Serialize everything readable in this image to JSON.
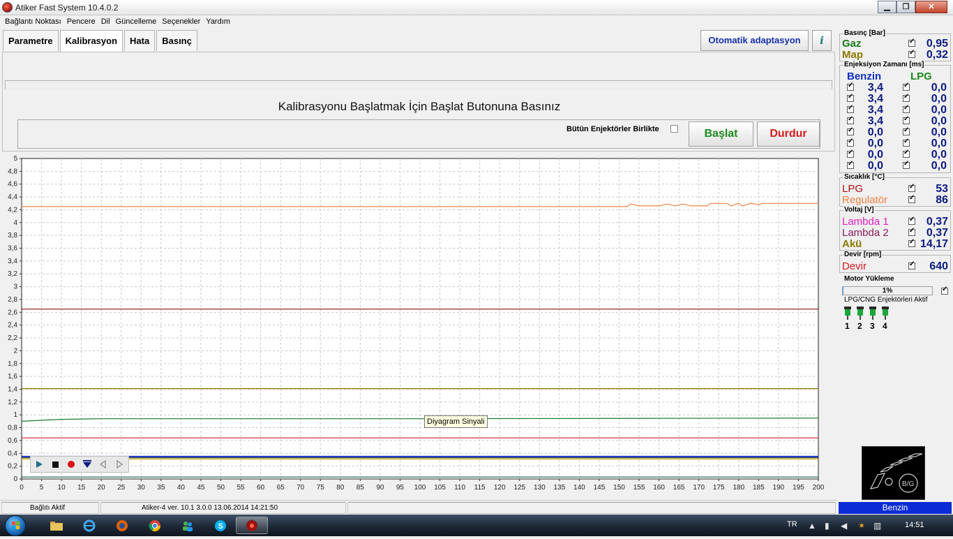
{
  "window": {
    "title": "Atiker Fast System  10.4.0.2",
    "buttons": {
      "minimize": "▁",
      "maximize": "❐",
      "close": "✕"
    }
  },
  "menu": [
    "Bağlantı Noktası",
    "Pencere",
    "Dil",
    "Güncelleme",
    "Seçenekler",
    "Yardım"
  ],
  "tabs": [
    "Parametre",
    "Kalibrasyon",
    "Hata",
    "Basınç"
  ],
  "active_tab": "Kalibrasyon",
  "auto_adapt_label": "Otomatik adaptasyon",
  "info_icon": "i",
  "calibration": {
    "message": "Kalibrasyonu Başlatmak İçin Başlat Butonuna Basınız",
    "all_injectors_label": "Bütün Enjektörler Birlikte",
    "start_label": "Başlat",
    "stop_label": "Durdur"
  },
  "tooltip": "Diyagram Sinyali",
  "chart_data": {
    "type": "line",
    "xlim": [
      0,
      200
    ],
    "ylim": [
      0,
      5
    ],
    "x_ticks": [
      0,
      5,
      10,
      15,
      20,
      25,
      30,
      35,
      40,
      45,
      50,
      55,
      60,
      65,
      70,
      75,
      80,
      85,
      90,
      95,
      100,
      105,
      110,
      115,
      120,
      125,
      130,
      135,
      140,
      145,
      150,
      155,
      160,
      165,
      170,
      175,
      180,
      185,
      190,
      195,
      200
    ],
    "y_ticks": [
      "0",
      "0,2",
      "0,4",
      "0,6",
      "0,8",
      "1",
      "1,2",
      "1,4",
      "1,6",
      "1,8",
      "2",
      "2,2",
      "2,4",
      "2,6",
      "2,8",
      "3",
      "3,2",
      "3,4",
      "3,6",
      "3,8",
      "4",
      "4,2",
      "4,4",
      "4,6",
      "4,8",
      "5"
    ],
    "grid": true,
    "series": [
      {
        "color": "#f08040",
        "points": [
          [
            0,
            4.25
          ],
          [
            152,
            4.25
          ],
          [
            153,
            4.29
          ],
          [
            155,
            4.26
          ],
          [
            160,
            4.26
          ],
          [
            162,
            4.29
          ],
          [
            164,
            4.26
          ],
          [
            166,
            4.29
          ],
          [
            168,
            4.26
          ],
          [
            172,
            4.26
          ],
          [
            173,
            4.3
          ],
          [
            177,
            4.3
          ],
          [
            178,
            4.26
          ],
          [
            180,
            4.3
          ],
          [
            181,
            4.26
          ],
          [
            183,
            4.3
          ],
          [
            185,
            4.28
          ],
          [
            186,
            4.3
          ],
          [
            200,
            4.3
          ]
        ]
      },
      {
        "color": "#8b1010",
        "points": [
          [
            0,
            2.65
          ],
          [
            200,
            2.65
          ]
        ]
      },
      {
        "color": "#8b7a00",
        "points": [
          [
            0,
            1.41
          ],
          [
            200,
            1.41
          ]
        ]
      },
      {
        "color": "#1a7a2a",
        "points": [
          [
            0,
            0.9
          ],
          [
            10,
            0.93
          ],
          [
            20,
            0.94
          ],
          [
            100,
            0.94
          ],
          [
            200,
            0.95
          ]
        ]
      },
      {
        "color": "#d42020",
        "points": [
          [
            0,
            0.64
          ],
          [
            200,
            0.64
          ]
        ]
      },
      {
        "color": "#1030c0",
        "points": [
          [
            0,
            0.35
          ],
          [
            200,
            0.35
          ]
        ]
      },
      {
        "color": "#2a2a2a",
        "points": [
          [
            0,
            0.33
          ],
          [
            200,
            0.33
          ]
        ]
      },
      {
        "color": "#c8b400",
        "points": [
          [
            0,
            0.31
          ],
          [
            200,
            0.31
          ]
        ]
      },
      {
        "color": "#0b5a5a",
        "points": [
          [
            0,
            0.03
          ],
          [
            200,
            0.03
          ]
        ]
      }
    ]
  },
  "player_icons": [
    "play-icon",
    "stop-icon",
    "record-icon",
    "marker-icon",
    "prev-icon",
    "next-icon"
  ],
  "pressure": {
    "title": "Basınç [Bar]",
    "rows": [
      {
        "label": "Gaz",
        "value": "0,95",
        "color": "#1a7a1a"
      },
      {
        "label": "Map",
        "value": "0,32",
        "color": "#8b7a00"
      }
    ]
  },
  "injection": {
    "title": "Enjeksiyon Zamanı [ms]",
    "benzin_label": "Benzin",
    "lpg_label": "LPG",
    "benzin": [
      "3,4",
      "3,4",
      "3,4",
      "3,4",
      "0,0",
      "0,0",
      "0,0",
      "0,0"
    ],
    "lpg": [
      "0,0",
      "0,0",
      "0,0",
      "0,0",
      "0,0",
      "0,0",
      "0,0",
      "0,0"
    ]
  },
  "temperature": {
    "title": "Sıcaklık  [°C]",
    "rows": [
      {
        "label": "LPG",
        "value": "53",
        "color": "#b01010"
      },
      {
        "label": "Regulatör",
        "value": "86",
        "color": "#f08040"
      }
    ]
  },
  "voltage": {
    "title": "Voltaj [V]",
    "rows": [
      {
        "label": "Lambda 1",
        "value": "0,37",
        "color": "#e020c0"
      },
      {
        "label": "Lambda 2",
        "value": "0,37",
        "color": "#8a1a5a"
      },
      {
        "label": "Akü",
        "value": "14,17",
        "color": "#8b7a00"
      }
    ]
  },
  "rpm": {
    "title": "Devir [rpm]",
    "label": "Devir",
    "value": "640",
    "color": "#d41c1c"
  },
  "motor_load": {
    "title": "Motor Yükleme",
    "value": "1%",
    "fraction": 0.01
  },
  "injectors_active": {
    "title": "LPG/CNG Enjektörleri Aktif",
    "numbers": [
      "1",
      "2",
      "3",
      "4"
    ]
  },
  "mode": "Benzin",
  "status": {
    "connection": "Bağlıtı Aktif",
    "device": "Atiker-4   ver. 10.1  3.0.0    13.06.2014 14:21:50"
  },
  "taskbar": {
    "lang": "TR",
    "clock": "14:51"
  }
}
